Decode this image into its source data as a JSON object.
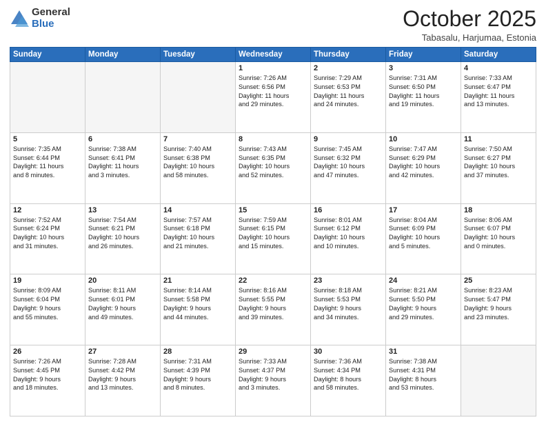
{
  "logo": {
    "general": "General",
    "blue": "Blue"
  },
  "header": {
    "month": "October 2025",
    "location": "Tabasalu, Harjumaa, Estonia"
  },
  "weekdays": [
    "Sunday",
    "Monday",
    "Tuesday",
    "Wednesday",
    "Thursday",
    "Friday",
    "Saturday"
  ],
  "weeks": [
    [
      {
        "day": "",
        "info": ""
      },
      {
        "day": "",
        "info": ""
      },
      {
        "day": "",
        "info": ""
      },
      {
        "day": "1",
        "info": "Sunrise: 7:26 AM\nSunset: 6:56 PM\nDaylight: 11 hours\nand 29 minutes."
      },
      {
        "day": "2",
        "info": "Sunrise: 7:29 AM\nSunset: 6:53 PM\nDaylight: 11 hours\nand 24 minutes."
      },
      {
        "day": "3",
        "info": "Sunrise: 7:31 AM\nSunset: 6:50 PM\nDaylight: 11 hours\nand 19 minutes."
      },
      {
        "day": "4",
        "info": "Sunrise: 7:33 AM\nSunset: 6:47 PM\nDaylight: 11 hours\nand 13 minutes."
      }
    ],
    [
      {
        "day": "5",
        "info": "Sunrise: 7:35 AM\nSunset: 6:44 PM\nDaylight: 11 hours\nand 8 minutes."
      },
      {
        "day": "6",
        "info": "Sunrise: 7:38 AM\nSunset: 6:41 PM\nDaylight: 11 hours\nand 3 minutes."
      },
      {
        "day": "7",
        "info": "Sunrise: 7:40 AM\nSunset: 6:38 PM\nDaylight: 10 hours\nand 58 minutes."
      },
      {
        "day": "8",
        "info": "Sunrise: 7:43 AM\nSunset: 6:35 PM\nDaylight: 10 hours\nand 52 minutes."
      },
      {
        "day": "9",
        "info": "Sunrise: 7:45 AM\nSunset: 6:32 PM\nDaylight: 10 hours\nand 47 minutes."
      },
      {
        "day": "10",
        "info": "Sunrise: 7:47 AM\nSunset: 6:29 PM\nDaylight: 10 hours\nand 42 minutes."
      },
      {
        "day": "11",
        "info": "Sunrise: 7:50 AM\nSunset: 6:27 PM\nDaylight: 10 hours\nand 37 minutes."
      }
    ],
    [
      {
        "day": "12",
        "info": "Sunrise: 7:52 AM\nSunset: 6:24 PM\nDaylight: 10 hours\nand 31 minutes."
      },
      {
        "day": "13",
        "info": "Sunrise: 7:54 AM\nSunset: 6:21 PM\nDaylight: 10 hours\nand 26 minutes."
      },
      {
        "day": "14",
        "info": "Sunrise: 7:57 AM\nSunset: 6:18 PM\nDaylight: 10 hours\nand 21 minutes."
      },
      {
        "day": "15",
        "info": "Sunrise: 7:59 AM\nSunset: 6:15 PM\nDaylight: 10 hours\nand 15 minutes."
      },
      {
        "day": "16",
        "info": "Sunrise: 8:01 AM\nSunset: 6:12 PM\nDaylight: 10 hours\nand 10 minutes."
      },
      {
        "day": "17",
        "info": "Sunrise: 8:04 AM\nSunset: 6:09 PM\nDaylight: 10 hours\nand 5 minutes."
      },
      {
        "day": "18",
        "info": "Sunrise: 8:06 AM\nSunset: 6:07 PM\nDaylight: 10 hours\nand 0 minutes."
      }
    ],
    [
      {
        "day": "19",
        "info": "Sunrise: 8:09 AM\nSunset: 6:04 PM\nDaylight: 9 hours\nand 55 minutes."
      },
      {
        "day": "20",
        "info": "Sunrise: 8:11 AM\nSunset: 6:01 PM\nDaylight: 9 hours\nand 49 minutes."
      },
      {
        "day": "21",
        "info": "Sunrise: 8:14 AM\nSunset: 5:58 PM\nDaylight: 9 hours\nand 44 minutes."
      },
      {
        "day": "22",
        "info": "Sunrise: 8:16 AM\nSunset: 5:55 PM\nDaylight: 9 hours\nand 39 minutes."
      },
      {
        "day": "23",
        "info": "Sunrise: 8:18 AM\nSunset: 5:53 PM\nDaylight: 9 hours\nand 34 minutes."
      },
      {
        "day": "24",
        "info": "Sunrise: 8:21 AM\nSunset: 5:50 PM\nDaylight: 9 hours\nand 29 minutes."
      },
      {
        "day": "25",
        "info": "Sunrise: 8:23 AM\nSunset: 5:47 PM\nDaylight: 9 hours\nand 23 minutes."
      }
    ],
    [
      {
        "day": "26",
        "info": "Sunrise: 7:26 AM\nSunset: 4:45 PM\nDaylight: 9 hours\nand 18 minutes."
      },
      {
        "day": "27",
        "info": "Sunrise: 7:28 AM\nSunset: 4:42 PM\nDaylight: 9 hours\nand 13 minutes."
      },
      {
        "day": "28",
        "info": "Sunrise: 7:31 AM\nSunset: 4:39 PM\nDaylight: 9 hours\nand 8 minutes."
      },
      {
        "day": "29",
        "info": "Sunrise: 7:33 AM\nSunset: 4:37 PM\nDaylight: 9 hours\nand 3 minutes."
      },
      {
        "day": "30",
        "info": "Sunrise: 7:36 AM\nSunset: 4:34 PM\nDaylight: 8 hours\nand 58 minutes."
      },
      {
        "day": "31",
        "info": "Sunrise: 7:38 AM\nSunset: 4:31 PM\nDaylight: 8 hours\nand 53 minutes."
      },
      {
        "day": "",
        "info": ""
      }
    ]
  ]
}
